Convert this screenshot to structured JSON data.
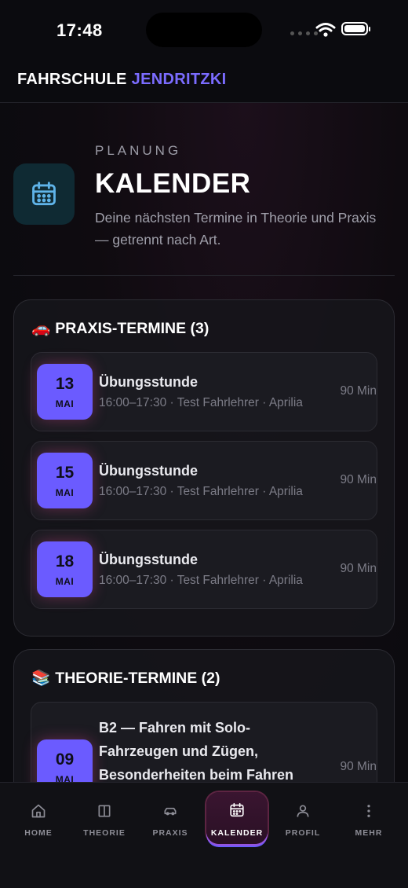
{
  "status_bar": {
    "time": "17:48"
  },
  "header": {
    "brand_first": "FAHRSCHULE",
    "brand_second": "JENDRITZKI"
  },
  "hero": {
    "eyebrow": "PLANUNG",
    "title": "KALENDER",
    "subtitle": "Deine nächsten Termine in Theorie und Praxis — getrennt nach Art.",
    "icon": "calendar-icon"
  },
  "praxis": {
    "emoji": "🚗",
    "title": "PRAXIS-TERMINE (3)",
    "items": [
      {
        "day": "13",
        "month": "MAI",
        "title": "Übungsstunde",
        "meta": "16:00–17:30 · Test Fahrlehrer · Aprilia",
        "duration": "90 Min"
      },
      {
        "day": "15",
        "month": "MAI",
        "title": "Übungsstunde",
        "meta": "16:00–17:30 · Test Fahrlehrer · Aprilia",
        "duration": "90 Min"
      },
      {
        "day": "18",
        "month": "MAI",
        "title": "Übungsstunde",
        "meta": "16:00–17:30 · Test Fahrlehrer · Aprilia",
        "duration": "90 Min"
      }
    ]
  },
  "theorie": {
    "emoji": "📚",
    "title": "THEORIE-TERMINE (2)",
    "items": [
      {
        "day": "09",
        "month": "MAI",
        "title": "B2 — Fahren mit Solo-Fahrzeugen und Zügen, Besonderheiten beim Fahren",
        "duration": "90 Min"
      }
    ]
  },
  "tabs": [
    {
      "label": "HOME",
      "icon": "home-icon"
    },
    {
      "label": "THEORIE",
      "icon": "book-icon"
    },
    {
      "label": "PRAXIS",
      "icon": "car-icon"
    },
    {
      "label": "KALENDER",
      "icon": "calendar-icon",
      "active": true
    },
    {
      "label": "PROFIL",
      "icon": "user-icon"
    },
    {
      "label": "MEHR",
      "icon": "more-vertical-icon"
    }
  ],
  "colors": {
    "accent": "#6b5bff",
    "active_glow": "#ec4899",
    "background": "#0b0b0f"
  }
}
